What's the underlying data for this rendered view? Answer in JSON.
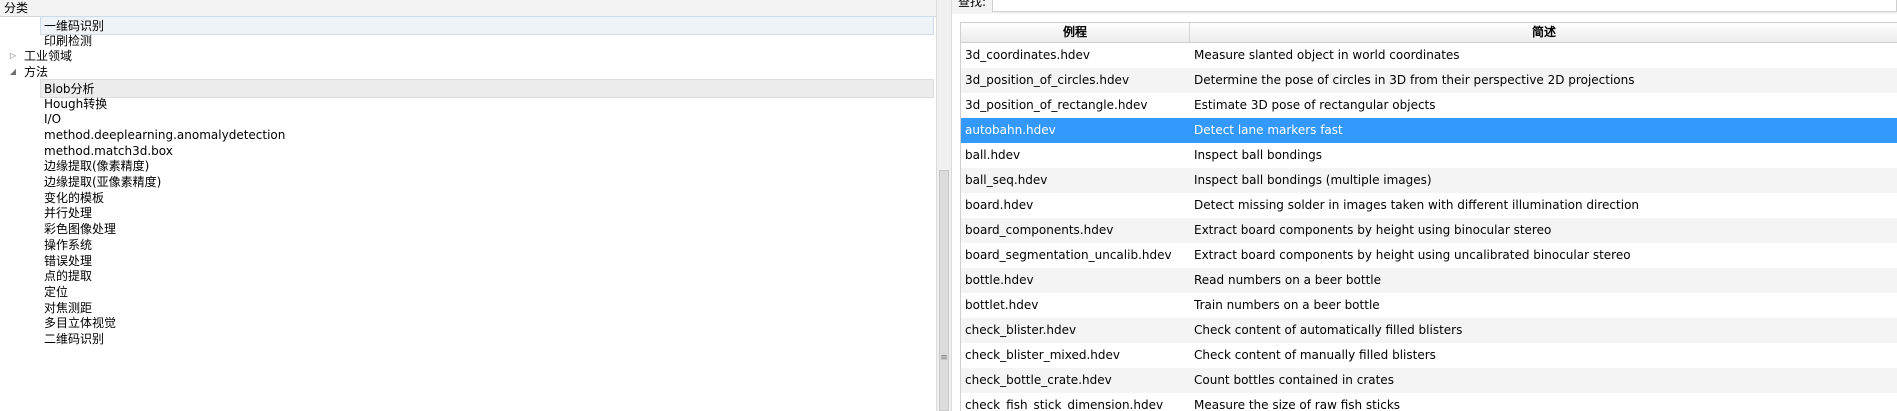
{
  "tree": {
    "header": "分类",
    "items": [
      {
        "label": "一维码识别",
        "level": 2,
        "state": "selected"
      },
      {
        "label": "印刷检测",
        "level": 2,
        "state": "none"
      },
      {
        "label": "工业领域",
        "level": 1,
        "expander": "collapsed"
      },
      {
        "label": "方法",
        "level": 1,
        "expander": "expanded"
      },
      {
        "label": "Blob分析",
        "level": 2,
        "state": "hover"
      },
      {
        "label": "Hough转换",
        "level": 2
      },
      {
        "label": "I/O",
        "level": 2
      },
      {
        "label": "method.deeplearning.anomalydetection",
        "level": 2
      },
      {
        "label": "method.match3d.box",
        "level": 2
      },
      {
        "label": "边缘提取(像素精度)",
        "level": 2
      },
      {
        "label": "边缘提取(亚像素精度)",
        "level": 2
      },
      {
        "label": "变化的模板",
        "level": 2
      },
      {
        "label": "并行处理",
        "level": 2
      },
      {
        "label": "彩色图像处理",
        "level": 2
      },
      {
        "label": "操作系统",
        "level": 2
      },
      {
        "label": "错误处理",
        "level": 2
      },
      {
        "label": "点的提取",
        "level": 2
      },
      {
        "label": "定位",
        "level": 2
      },
      {
        "label": "对焦测距",
        "level": 2
      },
      {
        "label": "多目立体视觉",
        "level": 2
      },
      {
        "label": "二维码识别",
        "level": 2
      }
    ]
  },
  "search": {
    "label": "查找:",
    "value": ""
  },
  "grid": {
    "columns": [
      "例程",
      "简述"
    ],
    "selected_index": 3,
    "rows": [
      [
        "3d_coordinates.hdev",
        "Measure slanted object in world coordinates"
      ],
      [
        "3d_position_of_circles.hdev",
        "Determine the pose of circles in 3D from their perspective 2D projections"
      ],
      [
        "3d_position_of_rectangle.hdev",
        "Estimate 3D pose of rectangular objects"
      ],
      [
        "autobahn.hdev",
        "Detect lane markers fast"
      ],
      [
        "ball.hdev",
        "Inspect ball bondings"
      ],
      [
        "ball_seq.hdev",
        "Inspect ball bondings (multiple images)"
      ],
      [
        "board.hdev",
        "Detect missing solder in images taken with different illumination direction"
      ],
      [
        "board_components.hdev",
        "Extract board components by height using binocular stereo"
      ],
      [
        "board_segmentation_uncalib.hdev",
        "Extract board components by height using uncalibrated binocular stereo"
      ],
      [
        "bottle.hdev",
        "Read numbers on a beer bottle"
      ],
      [
        "bottlet.hdev",
        "Train numbers on a beer bottle"
      ],
      [
        "check_blister.hdev",
        "Check content of automatically filled blisters"
      ],
      [
        "check_blister_mixed.hdev",
        "Check content of manually filled blisters"
      ],
      [
        "check_bottle_crate.hdev",
        "Count bottles contained in crates"
      ],
      [
        "check_fish_stick_dimension.hdev",
        "Measure the size of raw fish sticks"
      ]
    ]
  },
  "colors": {
    "selection": "#3399ff",
    "row_alt": "#f4f4f4",
    "tree_selected": "#eef3f8"
  }
}
